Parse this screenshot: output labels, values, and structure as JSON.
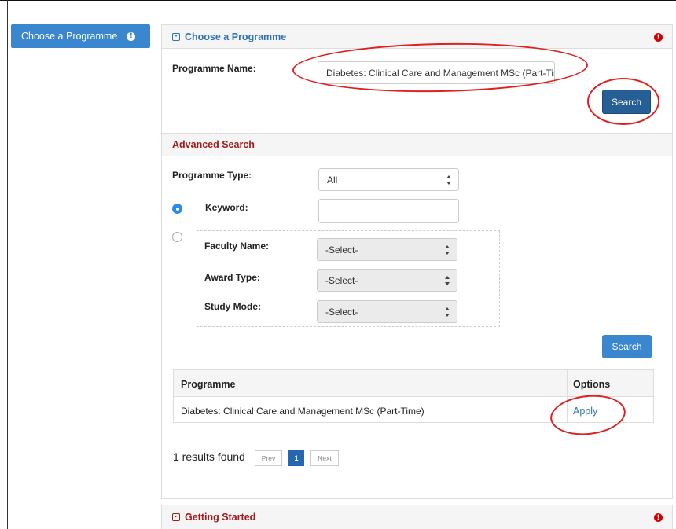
{
  "sidebar": {
    "choose_programme_label": "Choose a Programme",
    "alert_glyph": "!"
  },
  "choose_panel": {
    "heading": "Choose a Programme",
    "alert_glyph": "!",
    "programme_name_label": "Programme Name:",
    "programme_name_value": "Diabetes: Clinical Care and Management MSc (Part-Time)",
    "search_label": "Search"
  },
  "advanced_search": {
    "heading": "Advanced Search",
    "programme_type_label": "Programme Type:",
    "programme_type_value": "All",
    "keyword_label": "Keyword:",
    "keyword_value": "",
    "faculty_label": "Faculty Name:",
    "faculty_value": "-Select-",
    "award_label": "Award Type:",
    "award_value": "-Select-",
    "study_mode_label": "Study Mode:",
    "study_mode_value": "-Select-",
    "search_label": "Search"
  },
  "results": {
    "headers": {
      "programme": "Programme",
      "options": "Options"
    },
    "rows": [
      {
        "programme": "Diabetes: Clinical Care and Management MSc (Part-Time)",
        "action": "Apply"
      }
    ],
    "count_text": "1 results found",
    "pagination": {
      "prev": "Prev",
      "current": "1",
      "next": "Next"
    }
  },
  "getting_started": {
    "heading": "Getting Started",
    "alert_glyph": "!"
  },
  "colors": {
    "primary_blue": "#3a87cf",
    "section_red": "#a31a1a",
    "alert_red": "#d40000",
    "annotation_red": "#e02020"
  },
  "icons": [
    "exclamation-circle-icon",
    "collapse-toggle-icon",
    "expand-toggle-icon",
    "select-arrows-icon"
  ]
}
